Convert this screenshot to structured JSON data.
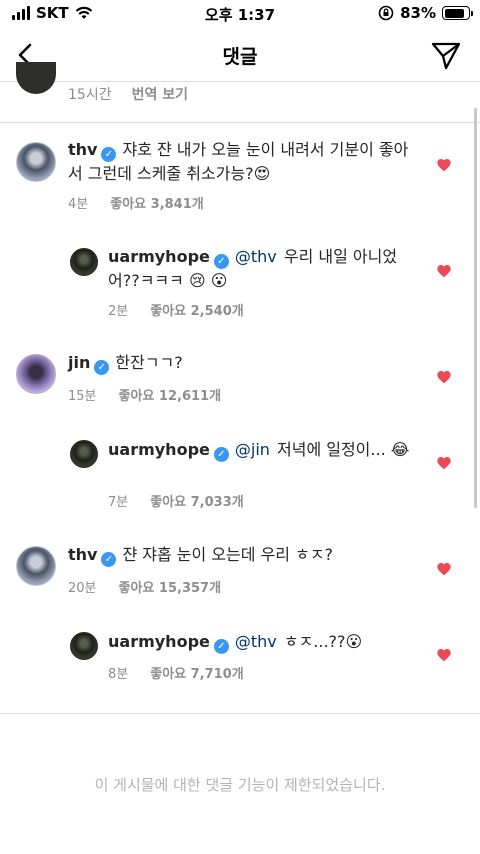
{
  "status_bar": {
    "carrier": "SKT",
    "time": "오후 1:37",
    "battery": "83%",
    "battery_level": 0.83
  },
  "header": {
    "title": "댓글",
    "back_icon": "chevron-left-icon",
    "send_icon": "paper-plane-icon"
  },
  "partial": {
    "time": "15시간",
    "translate": "번역 보기"
  },
  "comments": [
    {
      "user": "thv",
      "text": "쟈호 쟌 내가 오늘 눈이 내려서 기분이 좋아서 그런데 스케줄 취소가능?",
      "emoji": "😍",
      "time": "4분",
      "likes": "좋아요 3,841개"
    },
    {
      "user": "uarmyhope",
      "mention": "@thv",
      "text": "우리 내일 아니었어??ㅋㅋㅋ",
      "emoji": "😢 😮",
      "time": "2분",
      "likes": "좋아요 2,540개"
    },
    {
      "user": "jin",
      "text": "한잔ㄱㄱ?",
      "time": "15분",
      "likes": "좋아요 12,611개"
    },
    {
      "user": "uarmyhope",
      "mention": "@jin",
      "text": "저녁에 일정이...",
      "emoji": "😂",
      "time": "7분",
      "likes": "좋아요 7,033개"
    },
    {
      "user": "thv",
      "text": "쟌 쟈홉 눈이 오는데 우리 ㅎㅈ?",
      "time": "20분",
      "likes": "좋아요 15,357개"
    },
    {
      "user": "uarmyhope",
      "mention": "@thv",
      "text": "ㅎㅈ...??",
      "emoji": "😮",
      "time": "8분",
      "likes": "좋아요 7,710개"
    }
  ],
  "footer": {
    "restricted_text": "이 게시물에 대한 댓글 기능이 제한되었습니다."
  },
  "colors": {
    "heart": "#ed4956",
    "verified": "#3897f0",
    "mention": "#003569",
    "meta": "#8e8e8e"
  }
}
